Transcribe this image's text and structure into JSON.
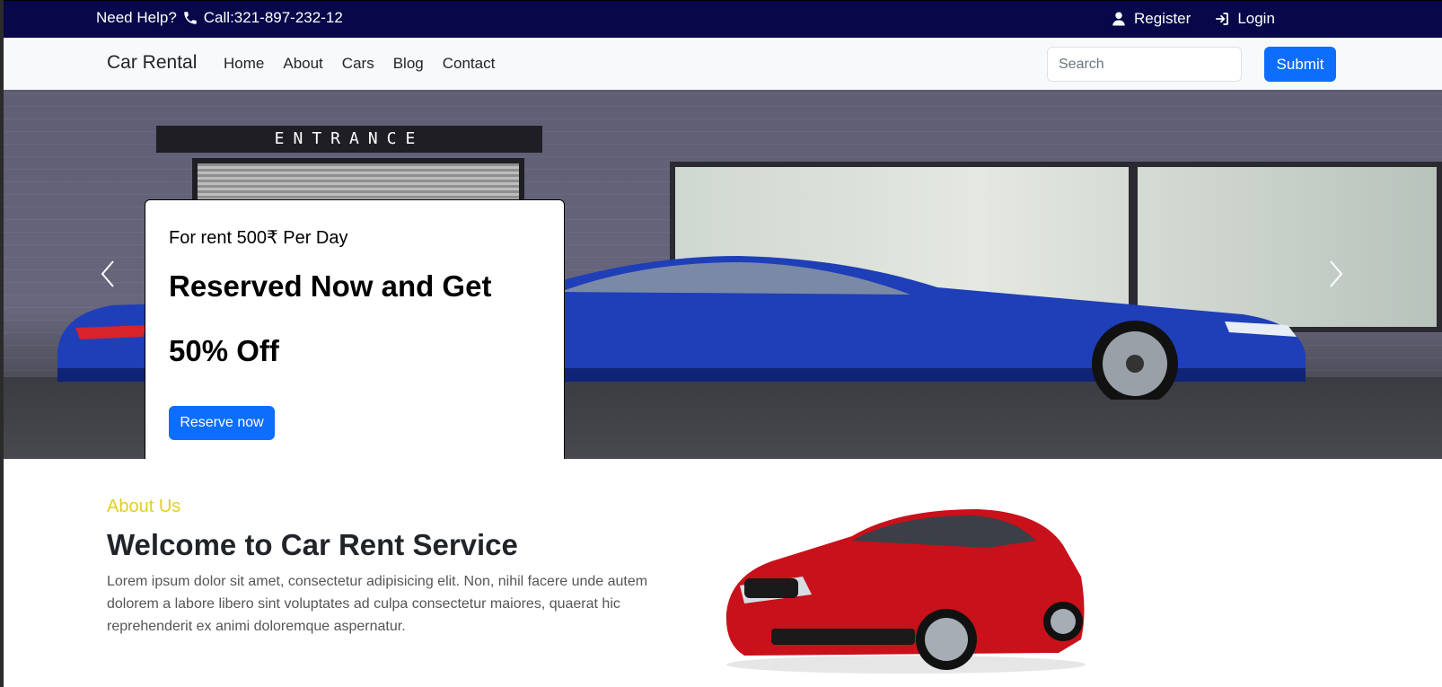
{
  "topbar": {
    "help_text": "Need Help?",
    "phone": "Call:321-897-232-12",
    "register_label": "Register",
    "login_label": "Login"
  },
  "navbar": {
    "brand": "Car Rental",
    "links": [
      "Home",
      "About",
      "Cars",
      "Blog",
      "Contact"
    ],
    "search_placeholder": "Search",
    "submit_label": "Submit"
  },
  "hero": {
    "sign_text": "ENTRANCE",
    "subtitle": "For rent 500₹ Per Day",
    "headline": "Reserved Now and Get 50% Off",
    "cta_label": "Reserve now"
  },
  "about": {
    "eyebrow": "About Us",
    "title": "Welcome to Car Rent Service",
    "text": "Lorem ipsum dolor sit amet, consectetur adipisicing elit. Non, nihil facere unde autem dolorem a labore libero sint voluptates ad culpa consectetur maiores, quaerat hic reprehenderit ex animi doloremque aspernatur."
  },
  "colors": {
    "topbar_bg": "#07074a",
    "primary": "#0d6efd",
    "eyebrow": "#e0cf1d"
  }
}
